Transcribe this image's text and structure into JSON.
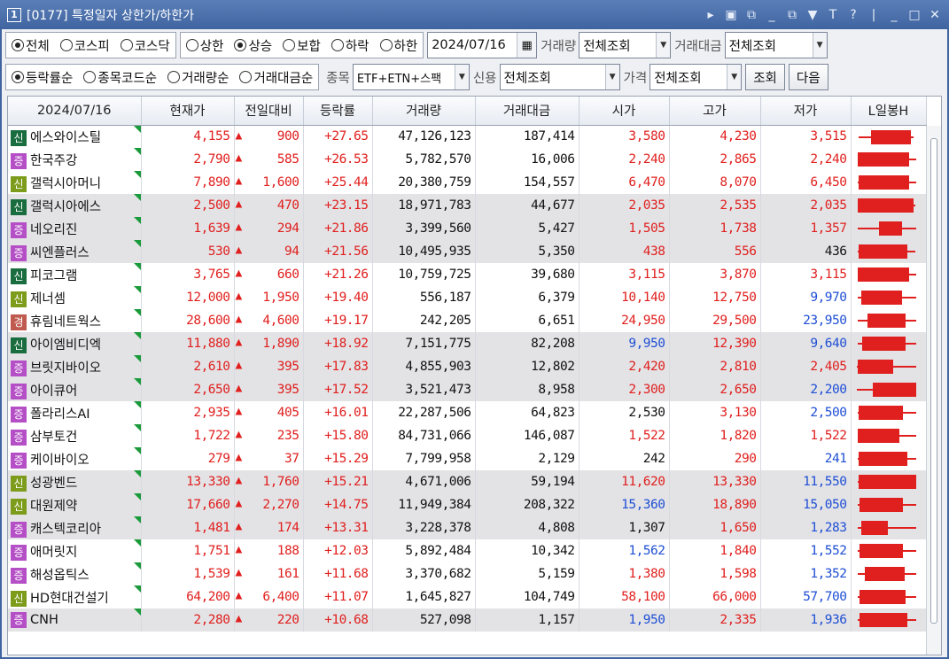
{
  "window": {
    "badge": "1",
    "title": "[0177] 특정일자 상한가/하한가"
  },
  "market": {
    "options": [
      "전체",
      "코스피",
      "코스닥"
    ],
    "selected": 0
  },
  "direction": {
    "options": [
      "상한",
      "상승",
      "보합",
      "하락",
      "하한"
    ],
    "selected": 1
  },
  "date": "2024/07/16",
  "volume": {
    "label": "거래량",
    "value": "전체조회"
  },
  "amount": {
    "label": "거래대금",
    "value": "전체조회"
  },
  "sort": {
    "options": [
      "등락률순",
      "종목코드순",
      "거래량순",
      "거래대금순"
    ],
    "selected": 0
  },
  "stock_type": {
    "label": "종목",
    "value": "ETF+ETN+스팩"
  },
  "credit": {
    "label": "신용",
    "value": "전체조회"
  },
  "price": {
    "label": "가격",
    "value": "전체조회"
  },
  "buttons": {
    "search": "조회",
    "next": "다음"
  },
  "columns": [
    "2024/07/16",
    "현재가",
    "전일대비",
    "등락률",
    "거래량",
    "거래대금",
    "시가",
    "고가",
    "저가",
    "L일봉H"
  ],
  "rows": [
    {
      "badge": "신",
      "bt": "sin",
      "name": "에스와이스틸",
      "cur": "4,155",
      "chg": "900",
      "rate": "+27.65",
      "vol": "47,126,123",
      "amt": "187,414",
      "open": "3,580",
      "oc": "up",
      "high": "4,230",
      "hc": "up",
      "low": "3,515",
      "lc": "up",
      "candle": [
        0.06,
        0.93,
        0.26,
        0.88
      ]
    },
    {
      "badge": "증",
      "bt": "jeung",
      "name": "한국주강",
      "cur": "2,790",
      "chg": "585",
      "rate": "+26.53",
      "vol": "5,782,570",
      "amt": "16,006",
      "open": "2,240",
      "oc": "up",
      "high": "2,865",
      "hc": "up",
      "low": "2,240",
      "lc": "up",
      "candle": [
        0.05,
        0.96,
        0.05,
        0.86
      ]
    },
    {
      "badge": "신",
      "bt": "sin2",
      "name": "갤럭시아머니",
      "cur": "7,890",
      "chg": "1,600",
      "rate": "+25.44",
      "vol": "20,380,759",
      "amt": "154,557",
      "open": "6,470",
      "oc": "up",
      "high": "8,070",
      "hc": "up",
      "low": "6,450",
      "lc": "up",
      "candle": [
        0.05,
        0.96,
        0.06,
        0.86
      ]
    },
    {
      "badge": "신",
      "bt": "sin",
      "name": "갤럭시아에스",
      "cur": "2,500",
      "chg": "470",
      "rate": "+23.15",
      "vol": "18,971,783",
      "amt": "44,677",
      "open": "2,035",
      "oc": "up",
      "high": "2,535",
      "hc": "up",
      "low": "2,035",
      "lc": "up",
      "candle": [
        0.05,
        0.95,
        0.05,
        0.93
      ]
    },
    {
      "badge": "증",
      "bt": "jeung",
      "name": "네오리진",
      "cur": "1,639",
      "chg": "294",
      "rate": "+21.86",
      "vol": "3,399,560",
      "amt": "5,427",
      "open": "1,505",
      "oc": "up",
      "high": "1,738",
      "hc": "up",
      "low": "1,357",
      "lc": "up",
      "candle": [
        0.05,
        0.96,
        0.38,
        0.74
      ]
    },
    {
      "badge": "증",
      "bt": "jeung",
      "name": "씨엔플러스",
      "cur": "530",
      "chg": "94",
      "rate": "+21.56",
      "vol": "10,495,935",
      "amt": "5,350",
      "open": "438",
      "oc": "up",
      "high": "556",
      "hc": "up",
      "low": "436",
      "lc": "flat",
      "candle": [
        0.05,
        0.95,
        0.06,
        0.82
      ]
    },
    {
      "badge": "신",
      "bt": "sin",
      "name": "피코그램",
      "cur": "3,765",
      "chg": "660",
      "rate": "+21.26",
      "vol": "10,759,725",
      "amt": "39,680",
      "open": "3,115",
      "oc": "up",
      "high": "3,870",
      "hc": "up",
      "low": "3,115",
      "lc": "up",
      "candle": [
        0.05,
        0.96,
        0.05,
        0.86
      ]
    },
    {
      "badge": "신",
      "bt": "sin2",
      "name": "제너셈",
      "cur": "12,000",
      "chg": "1,950",
      "rate": "+19.40",
      "vol": "556,187",
      "amt": "6,379",
      "open": "10,140",
      "oc": "up",
      "high": "12,750",
      "hc": "up",
      "low": "9,970",
      "lc": "dn",
      "candle": [
        0.05,
        0.96,
        0.1,
        0.75
      ]
    },
    {
      "badge": "경",
      "bt": "gyeong",
      "name": "휴림네트웍스",
      "cur": "28,600",
      "chg": "4,600",
      "rate": "+19.17",
      "vol": "242,205",
      "amt": "6,651",
      "open": "24,950",
      "oc": "up",
      "high": "29,500",
      "hc": "up",
      "low": "23,950",
      "lc": "dn",
      "candle": [
        0.05,
        0.96,
        0.2,
        0.8
      ]
    },
    {
      "badge": "신",
      "bt": "sin",
      "name": "아이엠비디엑",
      "cur": "11,880",
      "chg": "1,890",
      "rate": "+18.92",
      "vol": "7,151,775",
      "amt": "82,208",
      "open": "9,950",
      "oc": "dn",
      "high": "12,390",
      "hc": "up",
      "low": "9,640",
      "lc": "dn",
      "candle": [
        0.05,
        0.96,
        0.12,
        0.8
      ]
    },
    {
      "badge": "증",
      "bt": "jeung",
      "name": "브릿지바이오",
      "cur": "2,610",
      "chg": "395",
      "rate": "+17.83",
      "vol": "4,855,903",
      "amt": "12,802",
      "open": "2,420",
      "oc": "up",
      "high": "2,810",
      "hc": "up",
      "low": "2,405",
      "lc": "up",
      "candle": [
        0.03,
        0.96,
        0.05,
        0.6
      ]
    },
    {
      "badge": "증",
      "bt": "jeung",
      "name": "아이큐어",
      "cur": "2,650",
      "chg": "395",
      "rate": "+17.52",
      "vol": "3,521,473",
      "amt": "8,958",
      "open": "2,300",
      "oc": "up",
      "high": "2,650",
      "hc": "up",
      "low": "2,200",
      "lc": "dn",
      "candle": [
        0.03,
        0.96,
        0.28,
        0.96
      ]
    },
    {
      "badge": "증",
      "bt": "jeung",
      "name": "폴라리스AI",
      "cur": "2,935",
      "chg": "405",
      "rate": "+16.01",
      "vol": "22,287,506",
      "amt": "64,823",
      "open": "2,530",
      "oc": "flat",
      "high": "3,130",
      "hc": "up",
      "low": "2,500",
      "lc": "dn",
      "candle": [
        0.05,
        0.96,
        0.06,
        0.76
      ]
    },
    {
      "badge": "증",
      "bt": "jeung",
      "name": "삼부토건",
      "cur": "1,722",
      "chg": "235",
      "rate": "+15.80",
      "vol": "84,731,066",
      "amt": "146,087",
      "open": "1,522",
      "oc": "up",
      "high": "1,820",
      "hc": "up",
      "low": "1,522",
      "lc": "up",
      "candle": [
        0.05,
        0.96,
        0.05,
        0.7
      ]
    },
    {
      "badge": "증",
      "bt": "jeung",
      "name": "케이바이오",
      "cur": "279",
      "chg": "37",
      "rate": "+15.29",
      "vol": "7,799,958",
      "amt": "2,129",
      "open": "242",
      "oc": "flat",
      "high": "290",
      "hc": "up",
      "low": "241",
      "lc": "dn",
      "candle": [
        0.05,
        0.96,
        0.06,
        0.82
      ]
    },
    {
      "badge": "신",
      "bt": "sin2",
      "name": "성광벤드",
      "cur": "13,330",
      "chg": "1,760",
      "rate": "+15.21",
      "vol": "4,671,006",
      "amt": "59,194",
      "open": "11,620",
      "oc": "up",
      "high": "13,330",
      "hc": "up",
      "low": "11,550",
      "lc": "dn",
      "candle": [
        0.05,
        0.96,
        0.06,
        0.96
      ]
    },
    {
      "badge": "신",
      "bt": "sin2",
      "name": "대원제약",
      "cur": "17,660",
      "chg": "2,270",
      "rate": "+14.75",
      "vol": "11,949,384",
      "amt": "208,322",
      "open": "15,360",
      "oc": "dn",
      "high": "18,890",
      "hc": "up",
      "low": "15,050",
      "lc": "dn",
      "candle": [
        0.05,
        0.96,
        0.08,
        0.76
      ]
    },
    {
      "badge": "증",
      "bt": "jeung",
      "name": "캐스텍코리아",
      "cur": "1,481",
      "chg": "174",
      "rate": "+13.31",
      "vol": "3,228,378",
      "amt": "4,808",
      "open": "1,307",
      "oc": "flat",
      "high": "1,650",
      "hc": "up",
      "low": "1,283",
      "lc": "dn",
      "candle": [
        0.05,
        0.96,
        0.1,
        0.52
      ]
    },
    {
      "badge": "증",
      "bt": "jeung",
      "name": "애머릿지",
      "cur": "1,751",
      "chg": "188",
      "rate": "+12.03",
      "vol": "5,892,484",
      "amt": "10,342",
      "open": "1,562",
      "oc": "dn",
      "high": "1,840",
      "hc": "up",
      "low": "1,552",
      "lc": "dn",
      "candle": [
        0.05,
        0.96,
        0.07,
        0.76
      ]
    },
    {
      "badge": "증",
      "bt": "jeung",
      "name": "해성옵틱스",
      "cur": "1,539",
      "chg": "161",
      "rate": "+11.68",
      "vol": "3,370,682",
      "amt": "5,159",
      "open": "1,380",
      "oc": "up",
      "high": "1,598",
      "hc": "up",
      "low": "1,352",
      "lc": "dn",
      "candle": [
        0.05,
        0.96,
        0.16,
        0.78
      ]
    },
    {
      "badge": "신",
      "bt": "sin2",
      "name": "HD현대건설기",
      "cur": "64,200",
      "chg": "6,400",
      "rate": "+11.07",
      "vol": "1,645,827",
      "amt": "104,749",
      "open": "58,100",
      "oc": "up",
      "high": "66,000",
      "hc": "up",
      "low": "57,700",
      "lc": "dn",
      "candle": [
        0.05,
        0.96,
        0.08,
        0.8
      ]
    },
    {
      "badge": "증",
      "bt": "jeung",
      "name": "CNH",
      "cur": "2,280",
      "chg": "220",
      "rate": "+10.68",
      "vol": "527,098",
      "amt": "1,157",
      "open": "1,950",
      "oc": "dn",
      "high": "2,335",
      "hc": "up",
      "low": "1,936",
      "lc": "dn",
      "candle": [
        0.05,
        0.96,
        0.08,
        0.82
      ]
    }
  ]
}
